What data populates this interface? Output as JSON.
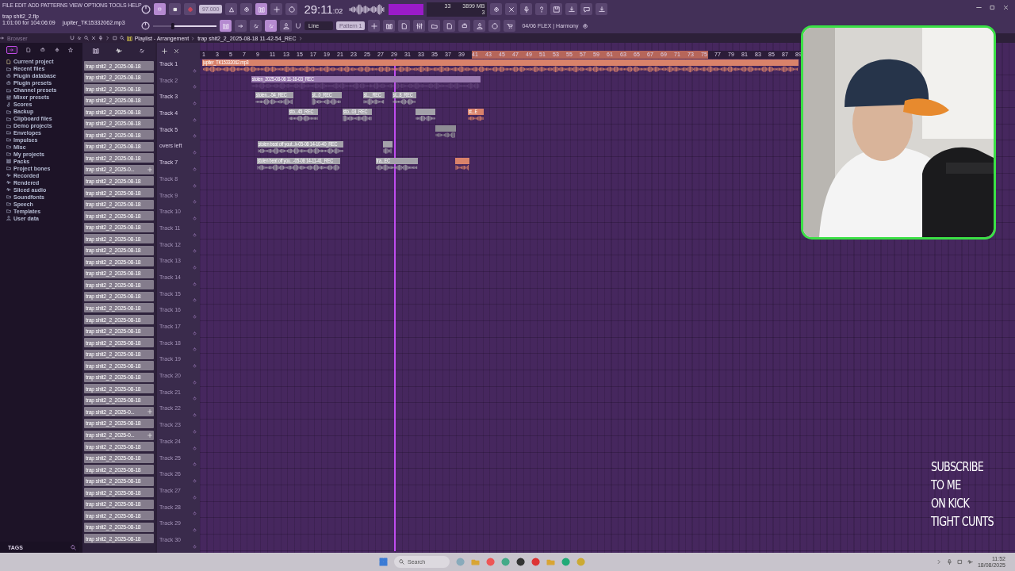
{
  "menu": [
    "FILE",
    "EDIT",
    "ADD",
    "PATTERNS",
    "VIEW",
    "OPTIONS",
    "TOOLS",
    "HELP"
  ],
  "project": {
    "file": "trap shit2_2.flp",
    "time": "1:01:00 for 104:06:09",
    "sample": "jupiter_TK15332062.mp3"
  },
  "transport": {
    "tempo": "97.000",
    "pattern": "Pattern 1",
    "snap": "Line"
  },
  "master_volume": {
    "level": 0.3
  },
  "clock": {
    "main": "29:11",
    "sub": ":02"
  },
  "cpu": {
    "value": "33",
    "memory": "3899 MB",
    "polyphony": "3"
  },
  "hint": "04/06  FLEX | Harmony",
  "browser": {
    "title": "Browser",
    "items": [
      {
        "label": "Current project",
        "kind": "file"
      },
      {
        "label": "Recent files",
        "kind": "folder"
      },
      {
        "label": "Plugin database",
        "kind": "plugin"
      },
      {
        "label": "Plugin presets",
        "kind": "plugin"
      },
      {
        "label": "Channel presets",
        "kind": "folder"
      },
      {
        "label": "Mixer presets",
        "kind": "mixer"
      },
      {
        "label": "Scores",
        "kind": "note"
      },
      {
        "label": "Backup",
        "kind": "folder"
      },
      {
        "label": "Clipboard files",
        "kind": "folder"
      },
      {
        "label": "Demo projects",
        "kind": "folder"
      },
      {
        "label": "Envelopes",
        "kind": "folder"
      },
      {
        "label": "Impulses",
        "kind": "folder"
      },
      {
        "label": "Misc",
        "kind": "folder"
      },
      {
        "label": "My projects",
        "kind": "folder"
      },
      {
        "label": "Packs",
        "kind": "pack"
      },
      {
        "label": "Project bones",
        "kind": "folder"
      },
      {
        "label": "Recorded",
        "kind": "wave"
      },
      {
        "label": "Rendered",
        "kind": "wave"
      },
      {
        "label": "Sliced audio",
        "kind": "wave"
      },
      {
        "label": "Soundfonts",
        "kind": "folder"
      },
      {
        "label": "Speech",
        "kind": "folder"
      },
      {
        "label": "Templates",
        "kind": "folder"
      },
      {
        "label": "User data",
        "kind": "user"
      }
    ],
    "tags": "TAGS"
  },
  "playlist": {
    "title": "Playlist - Arrangement",
    "path": "trap shit2_2_2025-08-18 11-42-54_REC"
  },
  "channels": [
    {
      "label": "trap shit2_2_2025-08-18",
      "kind": "audio"
    },
    {
      "label": "trap shit2_2_2025-08-18",
      "kind": "audio"
    },
    {
      "label": "trap shit2_2_2025-08-18",
      "kind": "audio"
    },
    {
      "label": "trap shit2_2_2025-08-18",
      "kind": "audio"
    },
    {
      "label": "trap shit2_2_2025-08-18",
      "kind": "audio"
    },
    {
      "label": "trap shit2_2_2025-08-18",
      "kind": "audio"
    },
    {
      "label": "trap shit2_2_2025-08-18",
      "kind": "audio"
    },
    {
      "label": "trap shit2_2_2025-08-18",
      "kind": "audio"
    },
    {
      "label": "trap shit2_2_2025-08-18",
      "kind": "audio"
    },
    {
      "label": "trap shit2_2_2025-0...",
      "kind": "audio-plus"
    },
    {
      "label": "trap shit2_2_2025-08-18",
      "kind": "audio"
    },
    {
      "label": "trap shit2_2_2025-08-18",
      "kind": "audio"
    },
    {
      "label": "trap shit2_2_2025-08-18",
      "kind": "audio"
    },
    {
      "label": "trap shit2_2_2025-08-18",
      "kind": "audio"
    },
    {
      "label": "trap shit2_2_2025-08-18",
      "kind": "audio"
    },
    {
      "label": "trap shit2_2_2025-08-18",
      "kind": "audio"
    },
    {
      "label": "trap shit2_2_2025-08-18",
      "kind": "audio"
    },
    {
      "label": "trap shit2_2_2025-08-18",
      "kind": "audio"
    },
    {
      "label": "trap shit2_2_2025-08-18",
      "kind": "audio"
    },
    {
      "label": "trap shit2_2_2025-08-18",
      "kind": "audio"
    },
    {
      "label": "trap shit2_2_2025-08-18",
      "kind": "audio"
    },
    {
      "label": "trap shit2_2_2025-08-18",
      "kind": "audio"
    },
    {
      "label": "trap shit2_2_2025-08-18",
      "kind": "audio"
    },
    {
      "label": "trap shit2_2_2025-08-18",
      "kind": "audio"
    },
    {
      "label": "trap shit2_2_2025-08-18",
      "kind": "audio"
    },
    {
      "label": "trap shit2_2_2025-08-18",
      "kind": "audio"
    },
    {
      "label": "trap shit2_2_2025-08-18",
      "kind": "audio"
    },
    {
      "label": "trap shit2_2_2025-08-18",
      "kind": "audio"
    },
    {
      "label": "trap shit2_2_2025-08-18",
      "kind": "audio"
    },
    {
      "label": "trap shit2_2_2025-08-18",
      "kind": "audio"
    },
    {
      "label": "trap shit2_2_2025-0...",
      "kind": "audio-plus"
    },
    {
      "label": "trap shit2_2_2025-08-18",
      "kind": "audio"
    },
    {
      "label": "trap shit2_2_2025-0...",
      "kind": "audio-plus"
    },
    {
      "label": "trap shit2_2_2025-08-18",
      "kind": "audio"
    },
    {
      "label": "trap shit2_2_2025-08-18",
      "kind": "audio"
    },
    {
      "label": "trap shit2_2_2025-08-18",
      "kind": "audio"
    },
    {
      "label": "trap shit2_2_2025-08-18",
      "kind": "audio"
    },
    {
      "label": "trap shit2_2_2025-08-18",
      "kind": "audio"
    },
    {
      "label": "trap shit2_2_2025-08-18",
      "kind": "audio"
    },
    {
      "label": "trap shit2_2_2025-08-18",
      "kind": "audio"
    },
    {
      "label": "trap shit2_2_2025-08-18",
      "kind": "audio"
    },
    {
      "label": "trap shit2_2_2025-08-18",
      "kind": "audio"
    }
  ],
  "ruler": [
    "1",
    "3",
    "5",
    "7",
    "9",
    "11",
    "13",
    "15",
    "17",
    "19",
    "21",
    "23",
    "25",
    "27",
    "29",
    "31",
    "33",
    "35",
    "37",
    "39",
    "41",
    "43",
    "45",
    "47",
    "49",
    "51",
    "53",
    "55",
    "57",
    "59",
    "61",
    "63",
    "65",
    "67",
    "69",
    "71",
    "73",
    "75",
    "77",
    "79",
    "81",
    "83",
    "85",
    "87",
    "89"
  ],
  "tracks": [
    {
      "name": "Track 1",
      "dimmed": false,
      "clips": [
        {
          "label": "jupiter_TK15332062.mp3",
          "color": "#d9826a",
          "muted": false
        }
      ]
    },
    {
      "name": "Track 2",
      "dimmed": true,
      "clips": [
        {
          "label": "stolen_2025-08-08 11-16-03_REC",
          "color": "#9a7ab0",
          "muted": true
        }
      ]
    },
    {
      "name": "Track 3",
      "dimmed": false,
      "clips": [
        {
          "label": "stolen...-54_REC",
          "color": "#a4a2aa",
          "muted": false
        },
        {
          "label": "st...0_REC",
          "color": "#a4a2aa",
          "muted": false
        },
        {
          "label": "st..._REC",
          "color": "#a4a2aa",
          "muted": false
        },
        {
          "label": "st...8_REC",
          "color": "#a4a2aa",
          "muted": false
        }
      ]
    },
    {
      "name": "Track 4",
      "dimmed": false,
      "clips": [
        {
          "label": "sto...45_REC",
          "color": "#a4a2aa",
          "muted": false
        },
        {
          "label": "sto...03_REC",
          "color": "#a4a2aa",
          "muted": false
        },
        {
          "color": "#a4a2aa",
          "muted": false
        },
        {
          "label": "st...E",
          "color": "#d9826a",
          "muted": false
        }
      ]
    },
    {
      "name": "Track 5",
      "dimmed": false,
      "clips": [
        {
          "color": "#8e8c94",
          "muted": false
        }
      ]
    },
    {
      "name": "overs left",
      "dimmed": false,
      "clips": [
        {
          "label": "stolen beat off yout...k-05-08 14-10-40_REC",
          "color": "#a4a2aa",
          "muted": false
        },
        {
          "color": "#a4a2aa",
          "muted": false
        }
      ]
    },
    {
      "name": "Track 7",
      "dimmed": false,
      "clips": [
        {
          "label": "stolen beat off you...-05-08 14-11-41_REC",
          "color": "#a4a2aa",
          "muted": false
        },
        {
          "label": "tra...EC",
          "color": "#a4a2aa",
          "muted": false
        },
        {
          "color": "#d9826a",
          "muted": false
        }
      ]
    },
    {
      "name": "Track 8",
      "dimmed": true
    },
    {
      "name": "Track 9",
      "dimmed": true
    },
    {
      "name": "Track 10",
      "dimmed": true
    },
    {
      "name": "Track 11",
      "dimmed": true
    },
    {
      "name": "Track 12",
      "dimmed": true
    },
    {
      "name": "Track 13",
      "dimmed": true
    },
    {
      "name": "Track 14",
      "dimmed": true
    },
    {
      "name": "Track 15",
      "dimmed": true
    },
    {
      "name": "Track 16",
      "dimmed": true
    },
    {
      "name": "Track 17",
      "dimmed": true
    },
    {
      "name": "Track 18",
      "dimmed": true
    },
    {
      "name": "Track 19",
      "dimmed": true
    },
    {
      "name": "Track 20",
      "dimmed": true
    },
    {
      "name": "Track 21",
      "dimmed": true
    },
    {
      "name": "Track 22",
      "dimmed": true
    },
    {
      "name": "Track 23",
      "dimmed": true
    },
    {
      "name": "Track 24",
      "dimmed": true
    },
    {
      "name": "Track 25",
      "dimmed": true
    },
    {
      "name": "Track 26",
      "dimmed": true
    },
    {
      "name": "Track 27",
      "dimmed": true
    },
    {
      "name": "Track 28",
      "dimmed": true
    },
    {
      "name": "Track 29",
      "dimmed": true
    },
    {
      "name": "Track 30",
      "dimmed": true
    }
  ],
  "overlay_text": [
    "SUBSCRIBE",
    "TO ME",
    "ON KICK",
    "TIGHT CUNTS"
  ],
  "taskbar": {
    "search": "Search",
    "time": "11:52",
    "date": "18/08/2025"
  }
}
